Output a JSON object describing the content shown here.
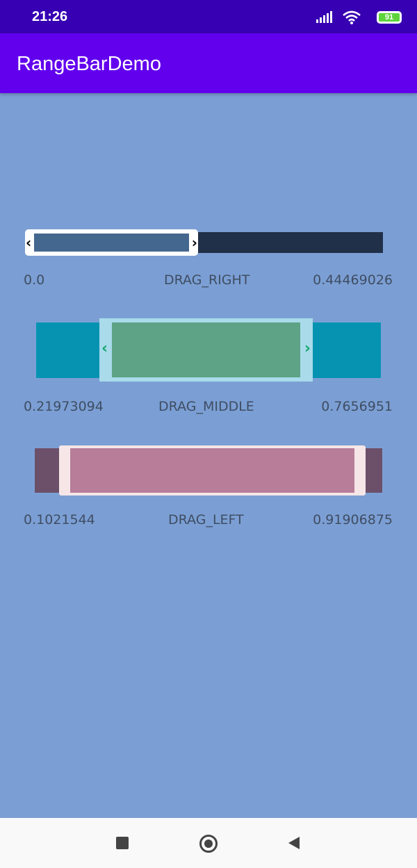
{
  "status_bar": {
    "time": "21:26",
    "battery": "91",
    "icons": [
      "signal-icon",
      "wifi-icon",
      "battery-icon"
    ]
  },
  "app_bar": {
    "title": "RangeBarDemo"
  },
  "range_bars": [
    {
      "mode": "DRAG_RIGHT",
      "min": "0.0",
      "max": "0.44469026",
      "colors": {
        "track": "#213049",
        "thumb": "#ffffff",
        "fill": "#44678f",
        "handle": "#000000"
      }
    },
    {
      "mode": "DRAG_MIDDLE",
      "min": "0.21973094",
      "max": "0.7656951",
      "colors": {
        "track": "#0693b2",
        "thumb": "#a9dbeb",
        "fill": "#5ea385",
        "handle": "#18a66b"
      }
    },
    {
      "mode": "DRAG_LEFT",
      "min": "0.1021544",
      "max": "0.91906875",
      "colors": {
        "track": "#6c5069",
        "thumb": "#f6e6e8",
        "fill": "#b77d99"
      }
    }
  ],
  "nav_bar": {
    "buttons": [
      "recents-button",
      "home-button",
      "back-button"
    ]
  },
  "colors": {
    "background": "#7b9fd4",
    "status_bar": "#3700b3",
    "app_bar": "#6200ee",
    "label_text": "#3f4d63"
  }
}
